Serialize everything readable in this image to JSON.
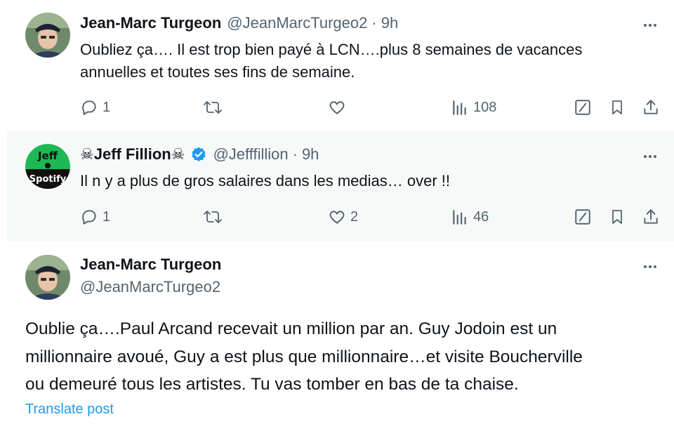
{
  "tweets": [
    {
      "name": "Jean-Marc Turgeon",
      "handle": "@JeanMarcTurgeo2",
      "sep": "·",
      "time": "9h",
      "text_line1": "Oubliez ça…. Il est trop bien payé à LCN….plus 8 semaines de vacances",
      "text_line2": "annuelles et toutes ses fins de semaine.",
      "replies": "1",
      "retweets": "",
      "likes": "",
      "views": "108"
    },
    {
      "name_prefix": "☠",
      "name": "Jeff Fillion",
      "name_suffix": "☠",
      "handle": "@Jefffillion",
      "sep": "·",
      "time": "9h",
      "verified": true,
      "avatar_lines": [
        "Jeff",
        "Spotify"
      ],
      "text_line1": "Il n y a plus de gros salaires dans les medias… over !!",
      "replies": "1",
      "retweets": "",
      "likes": "2",
      "views": "46"
    },
    {
      "name": "Jean-Marc Turgeon",
      "handle": "@JeanMarcTurgeo2",
      "text_line1": "Oublie ça….Paul Arcand recevait un million par an. Guy Jodoin est un",
      "text_line2": "millionnaire avoué, Guy a est plus que millionnaire…et visite Boucherville",
      "text_line3": "ou demeuré tous les artistes. Tu vas tomber en bas de ta chaise.",
      "translate": "Translate post"
    }
  ],
  "icons": {
    "more": "more-icon",
    "reply": "reply-icon",
    "retweet": "retweet-icon",
    "like": "heart-icon",
    "views": "views-icon",
    "grok": "grok-icon",
    "bookmark": "bookmark-icon",
    "share": "share-icon",
    "verified": "verified-badge-icon"
  },
  "colors": {
    "text": "#0f1419",
    "secondary": "#536471",
    "link": "#1d9bf0",
    "verified": "#1d9bf0",
    "highlight_bg": "#f7f9f9",
    "thread_line": "#cfd9de",
    "spotify_green": "#1db954"
  }
}
